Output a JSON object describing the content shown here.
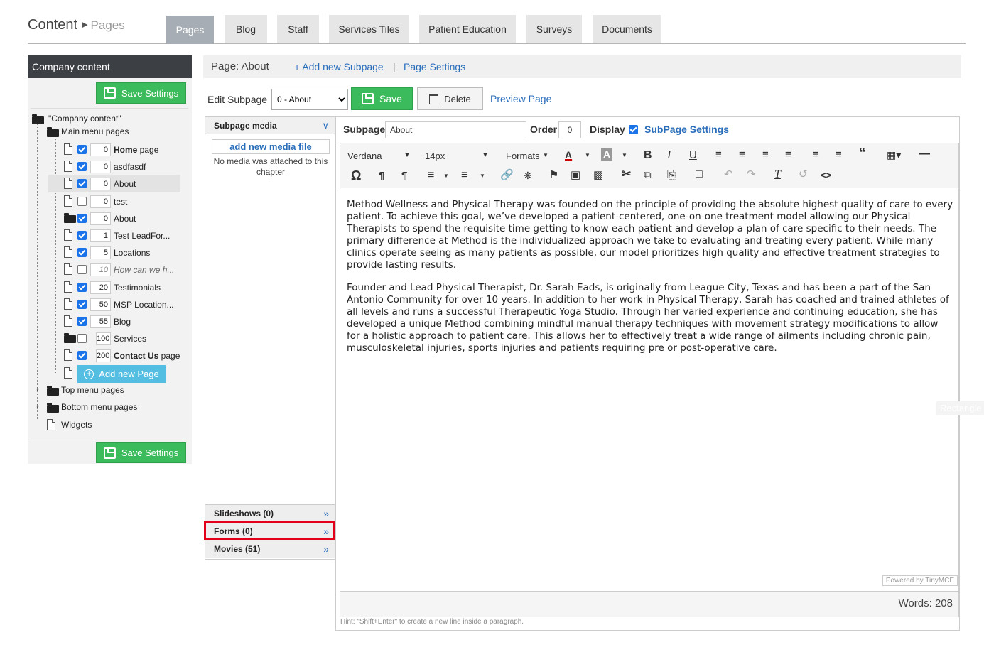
{
  "breadcrumb": {
    "title": "Content",
    "sub": "Pages"
  },
  "tabs": [
    "Pages",
    "Blog",
    "Staff",
    "Services Tiles",
    "Patient Education",
    "Surveys",
    "Documents"
  ],
  "left": {
    "header": "Company content",
    "save_label": "Save Settings",
    "root": "\"Company content\"",
    "main_menu": "Main menu pages",
    "pages": [
      {
        "order": "0",
        "name": "Home",
        "suffix": " page",
        "bold": true,
        "checked": true
      },
      {
        "order": "0",
        "name": "asdfasdf",
        "suffix": "",
        "bold": false,
        "checked": true
      },
      {
        "order": "0",
        "name": "About",
        "suffix": "",
        "bold": false,
        "checked": true
      },
      {
        "order": "0",
        "name": "test",
        "suffix": "",
        "bold": false,
        "checked": false
      },
      {
        "order": "0",
        "name": "About",
        "suffix": "",
        "bold": false,
        "checked": true
      },
      {
        "order": "1",
        "name": "Test LeadFor...",
        "suffix": "",
        "bold": false,
        "checked": true
      },
      {
        "order": "5",
        "name": "Locations",
        "suffix": "",
        "bold": false,
        "checked": true
      },
      {
        "order": "10",
        "name": "How can we h...",
        "suffix": "",
        "bold": false,
        "checked": false
      },
      {
        "order": "20",
        "name": "Testimonials",
        "suffix": "",
        "bold": false,
        "checked": true
      },
      {
        "order": "50",
        "name": "MSP Location...",
        "suffix": "",
        "bold": false,
        "checked": true
      },
      {
        "order": "55",
        "name": "Blog",
        "suffix": "",
        "bold": false,
        "checked": true
      },
      {
        "order": "100",
        "name": "Services",
        "suffix": "",
        "bold": false,
        "checked": false
      },
      {
        "order": "200",
        "name": "Contact Us",
        "suffix": " page",
        "bold": true,
        "checked": true
      }
    ],
    "add_new_page": "Add new Page",
    "top_menu": "Top menu pages",
    "bottom_menu": "Bottom menu pages",
    "widgets": "Widgets"
  },
  "pagebar": {
    "page_label": "Page: About",
    "add_subpage": "+ Add new Subpage",
    "separator": "|",
    "page_settings": "Page Settings"
  },
  "editrow": {
    "label": "Edit Subpage",
    "selected": "0 - About",
    "save": "Save",
    "delete": "Delete",
    "preview": "Preview Page"
  },
  "media": {
    "header": "Subpage media",
    "add_file": "add new media file",
    "empty": "No media was attached to this chapter",
    "slideshows": "Slideshows (0)",
    "forms": "Forms (0)",
    "movies": "Movies (51)"
  },
  "subpage_row": {
    "subpage_label": "Subpage",
    "subpage_value": "About",
    "order_label": "Order",
    "order_value": "0",
    "display_label": "Display",
    "display_checked": true,
    "settings_link": "SubPage Settings"
  },
  "toolbar": {
    "font": "Verdana",
    "size": "14px",
    "formats": "Formats"
  },
  "content": {
    "p1": "Method Wellness and Physical Therapy was founded on the principle of providing the absolute highest quality of care to every patient. To achieve this goal, we’ve developed a patient-centered, one-on-one treatment model allowing our Physical Therapists to spend the requisite time getting to know each patient and develop a plan of care specific to their needs. The primary difference at Method is the individualized approach we take to evaluating and treating every patient. While many clinics operate seeing as many patients as possible, our model prioritizes high quality and effective treatment strategies to provide lasting results.",
    "p2": "Founder and Lead Physical Therapist, Dr. Sarah Eads, is originally from League City, Texas and has been a part of the San Antonio Community for over 10 years.  In addition to her work in Physical Therapy, Sarah has coached and trained athletes of all levels and runs a successful Therapeutic Yoga Studio.  Through her varied experience and continuing education, she has developed a unique Method combining mindful manual therapy techniques with movement strategy modifications to allow for a holistic approach to patient care. This allows her to effectively treat a wide range of ailments including chronic pain, musculoskeletal injuries, sports injuries and patients requiring pre or post-operative care."
  },
  "powered_by": "Powered by TinyMCE",
  "words": "Words: 208",
  "hint": "Hint: \"Shift+Enter\" to create a new line inside a paragraph.",
  "tooltip": "Rectangle"
}
